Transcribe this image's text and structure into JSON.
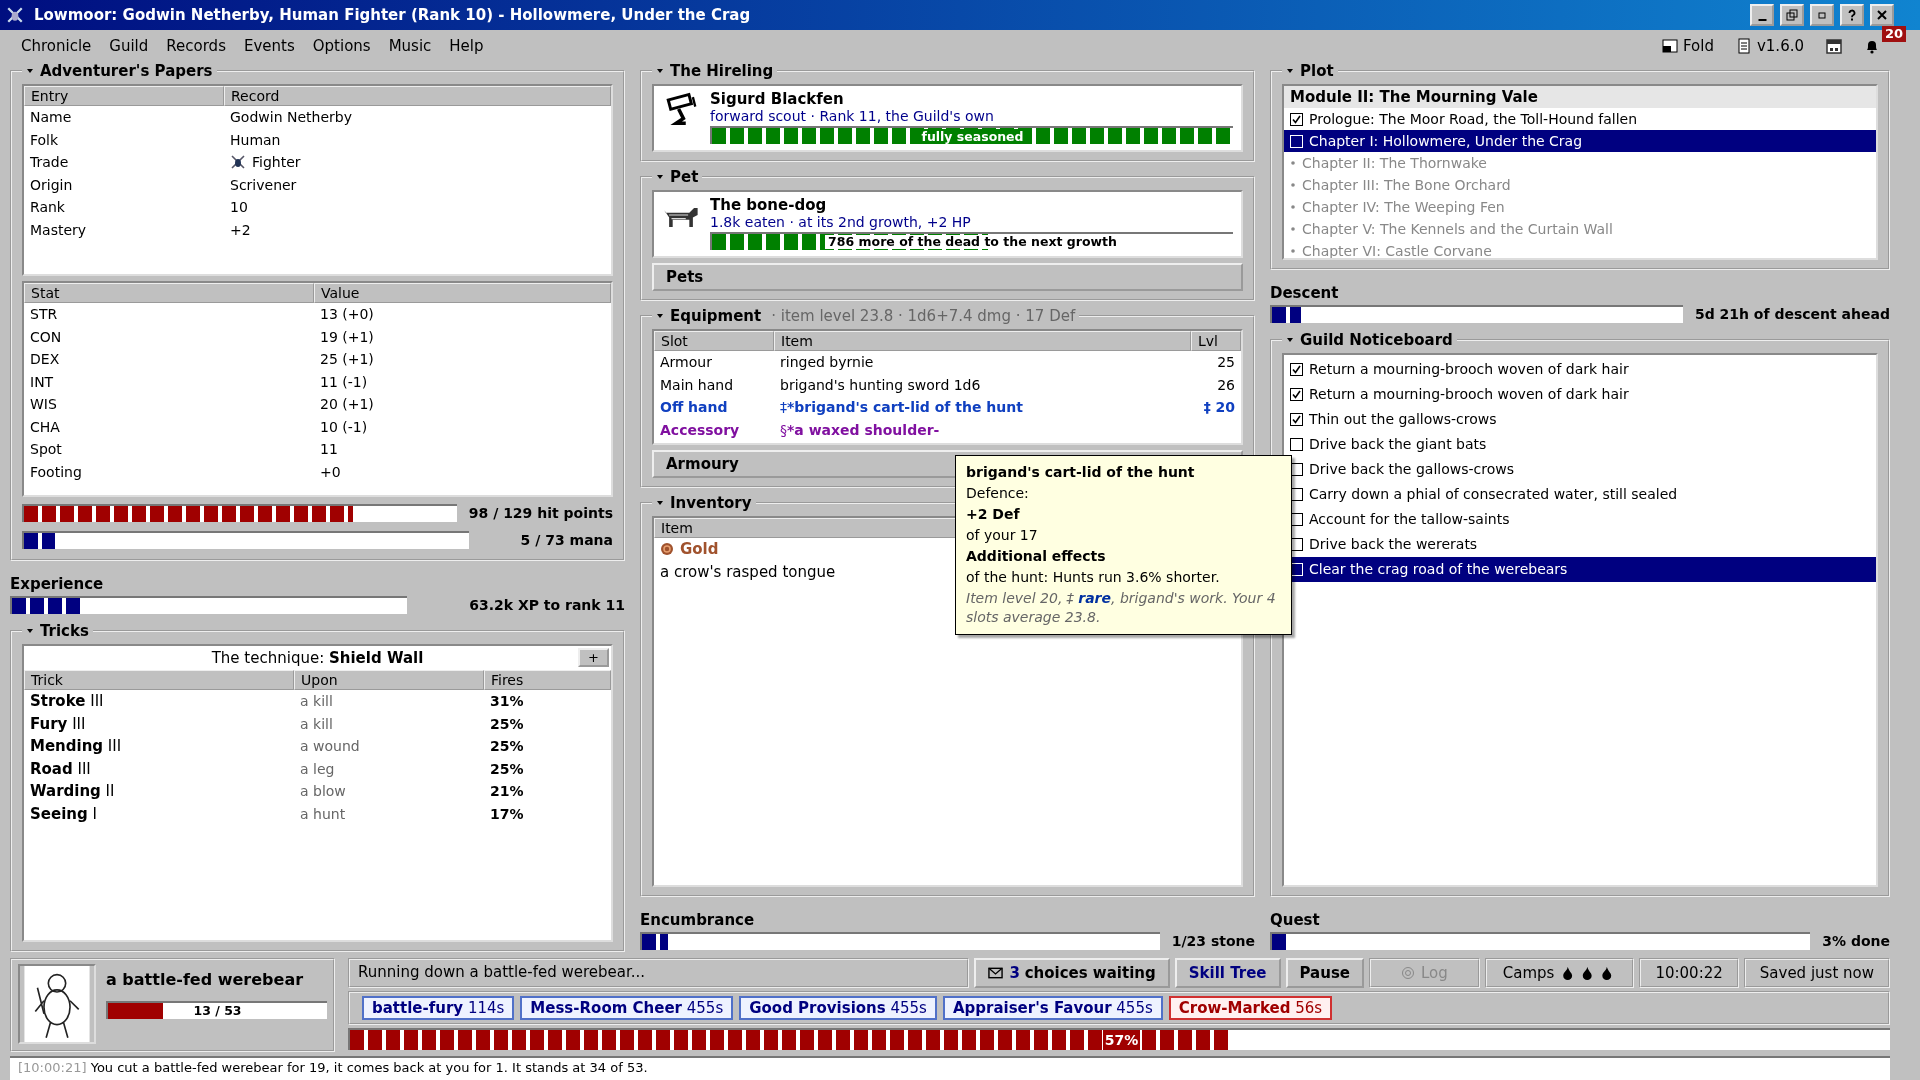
{
  "window": {
    "title": "Lowmoor: Godwin Netherby, Human Fighter (Rank 10) - Hollowmere, Under the Crag"
  },
  "menu": [
    "Chronicle",
    "Guild",
    "Records",
    "Events",
    "Options",
    "Music",
    "Help"
  ],
  "toolbar": {
    "fold": "Fold",
    "version": "v1.6.0",
    "notifications": "20"
  },
  "papers": {
    "title": "Adventurer's Papers",
    "record_columns": [
      "Entry",
      "Record"
    ],
    "records": [
      {
        "entry": "Name",
        "value": "Godwin Netherby",
        "kind": "text"
      },
      {
        "entry": "Folk",
        "value": "Human",
        "kind": "text"
      },
      {
        "entry": "Trade",
        "value": "Fighter",
        "kind": "trade"
      },
      {
        "entry": "Origin",
        "value": "Scrivener",
        "kind": "text"
      },
      {
        "entry": "Rank",
        "value": "10",
        "kind": "text"
      },
      {
        "entry": "Mastery",
        "value": "+2",
        "kind": "text"
      }
    ],
    "stat_columns": [
      "Stat",
      "Value"
    ],
    "stats": [
      {
        "stat": "STR",
        "value": "13 (+0)"
      },
      {
        "stat": "CON",
        "value": "19 (+1)"
      },
      {
        "stat": "DEX",
        "value": "25 (+1)"
      },
      {
        "stat": "INT",
        "value": "11 (-1)"
      },
      {
        "stat": "WIS",
        "value": "20 (+1)"
      },
      {
        "stat": "CHA",
        "value": "10 (-1)"
      },
      {
        "stat": "Spot",
        "value": "11"
      },
      {
        "stat": "Footing",
        "value": "+0"
      }
    ],
    "hp": {
      "level": 0.76,
      "reading": "98 / 129 hit points"
    },
    "mana": {
      "level": 0.07,
      "reading": "5 / 73 mana"
    }
  },
  "experience": {
    "title": "Experience",
    "level": 0.18,
    "reading": "63.2k XP to rank 11"
  },
  "tricks": {
    "title": "Tricks",
    "technique": "The technique: **Shield Wall**",
    "add": "+",
    "columns": [
      "Trick",
      "Upon",
      "Fires"
    ],
    "rows": [
      {
        "trick": "**Stroke** III",
        "upon": "a kill",
        "fires": "31%"
      },
      {
        "trick": "**Fury** III",
        "upon": "a kill",
        "fires": "25%"
      },
      {
        "trick": "**Mending** III",
        "upon": "a wound",
        "fires": "25%"
      },
      {
        "trick": "**Road** III",
        "upon": "a leg",
        "fires": "25%"
      },
      {
        "trick": "**Warding** II",
        "upon": "a blow",
        "fires": "21%"
      },
      {
        "trick": "**Seeing** I",
        "upon": "a hunt",
        "fires": "17%"
      }
    ]
  },
  "hireling": {
    "title": "The Hireling",
    "name": "Sigurd Blackfen",
    "detail": "forward scout · Rank 11, the Guild's own",
    "level": 1,
    "bar_label": "fully seasoned"
  },
  "pet": {
    "title": "Pet",
    "name": "The bone-dog",
    "detail": "1.8k eaten · at its 2nd growth, +2 HP",
    "level": 0.53,
    "bar_label": "786 more of the dead to the next growth",
    "button": "Pets"
  },
  "equipment": {
    "title": "Equipment",
    "summary": "· item level 23.8 · 1d6+7.4 dmg · 17 Def",
    "columns": [
      "Slot",
      "Item",
      "Lvl"
    ],
    "rows": [
      {
        "slot": "Armour",
        "item": "ringed byrnie",
        "lvl": "25",
        "kind": "common"
      },
      {
        "slot": "Main hand",
        "item": "brigand's hunting sword 1d6",
        "lvl": "26",
        "kind": "common"
      },
      {
        "slot": "Off hand",
        "mark": "‡",
        "item": "*brigand's cart-lid of the hunt",
        "lvl": "‡ 20",
        "kind": "rare"
      },
      {
        "slot": "Accessory",
        "mark": "§",
        "item": "*a waxed shoulder-",
        "kind": "epic"
      }
    ],
    "button": "Armoury"
  },
  "tooltip": {
    "title": "brigand's cart-lid of the hunt",
    "lines": [
      {
        "kind": "plain",
        "text": "Defence:"
      },
      {
        "kind": "bold",
        "text": "+2 Def"
      },
      {
        "kind": "plain",
        "text": "of your 17"
      },
      {
        "kind": "heading",
        "text": "Additional effects"
      },
      {
        "kind": "plain",
        "text": "of the hunt: Hunts run 3.6% shorter."
      },
      {
        "kind": "note",
        "text": "Item level 20, ‡ **rare**, brigand's work. Your 4 slots average 23.8."
      }
    ]
  },
  "inventory": {
    "title": "Inventory",
    "column": "Item",
    "rows": [
      {
        "text": "Gold",
        "kind": "gold"
      },
      {
        "text": "a crow's rasped tongue",
        "kind": "plain"
      }
    ]
  },
  "encumbrance": {
    "title": "Encumbrance",
    "level": 0.05,
    "reading": "1/23 stone"
  },
  "plot": {
    "title": "Plot",
    "module": "Module II: The Mourning Vale",
    "chapters": [
      {
        "text": "Prologue: The Moor Road, the Toll-Hound fallen",
        "kind": "done",
        "selected": false
      },
      {
        "text": "Chapter I: Hollowmere, Under the Crag",
        "kind": "current",
        "selected": true
      },
      {
        "text": "Chapter II: The Thornwake",
        "kind": "locked",
        "selected": false
      },
      {
        "text": "Chapter III: The Bone Orchard",
        "kind": "locked",
        "selected": false
      },
      {
        "text": "Chapter IV: The Weeping Fen",
        "kind": "locked",
        "selected": false
      },
      {
        "text": "Chapter V: The Kennels and the Curtain Wall",
        "kind": "locked",
        "selected": false
      },
      {
        "text": "Chapter VI: Castle Corvane",
        "kind": "locked",
        "selected": false
      }
    ]
  },
  "descent": {
    "title": "Descent",
    "level": 0.07,
    "reading": "5d 21h of descent ahead"
  },
  "noticeboard": {
    "title": "Guild Noticeboard",
    "items": [
      {
        "text": "Return a mourning-brooch woven of dark hair",
        "checked": true,
        "selected": false
      },
      {
        "text": "Return a mourning-brooch woven of dark hair",
        "checked": true,
        "selected": false
      },
      {
        "text": "Thin out the gallows-crows",
        "checked": true,
        "selected": false
      },
      {
        "text": "Drive back the giant bats",
        "checked": false,
        "selected": false
      },
      {
        "text": "Drive back the gallows-crows",
        "checked": false,
        "selected": false
      },
      {
        "text": "Carry down a phial of consecrated water, still sealed",
        "checked": false,
        "selected": false
      },
      {
        "text": "Account for the tallow-saints",
        "checked": false,
        "selected": false
      },
      {
        "text": "Drive back the wererats",
        "checked": false,
        "selected": false
      },
      {
        "text": "Clear the crag road of the werebears",
        "checked": false,
        "selected": true
      }
    ]
  },
  "quest": {
    "title": "Quest",
    "level": 0.03,
    "reading": "3% done"
  },
  "monster": {
    "name": "a battle-fed werebear",
    "level": 0.25,
    "reading": "13 / 53"
  },
  "status": {
    "activity": "Running down a battle-fed werebear...",
    "choices_count": "3",
    "choices_label": "choices waiting",
    "buttons": [
      {
        "label": "Skill Tree",
        "kind": "link"
      },
      {
        "label": "Pause",
        "kind": "strong"
      }
    ],
    "log": {
      "label": "Log",
      "disabled": true
    },
    "camps": "Camps",
    "clock": "10:00:22",
    "saved": "Saved just now"
  },
  "buffs": [
    {
      "name": "battle-fury",
      "time": "114s",
      "kind": "boon"
    },
    {
      "name": "Mess-Room Cheer",
      "time": "455s",
      "kind": "boon"
    },
    {
      "name": "Good Provisions",
      "time": "455s",
      "kind": "boon"
    },
    {
      "name": "Appraiser's Favour",
      "time": "455s",
      "kind": "boon"
    },
    {
      "name": "Crow-Marked",
      "time": "56s",
      "kind": "bane"
    }
  ],
  "progress": {
    "level": 0.57,
    "label": "57%"
  },
  "log": {
    "time": "[10:00:21]",
    "text": "You cut a battle-fed werebear for 19, it comes back at you for 1. It stands at 34 of 53."
  }
}
